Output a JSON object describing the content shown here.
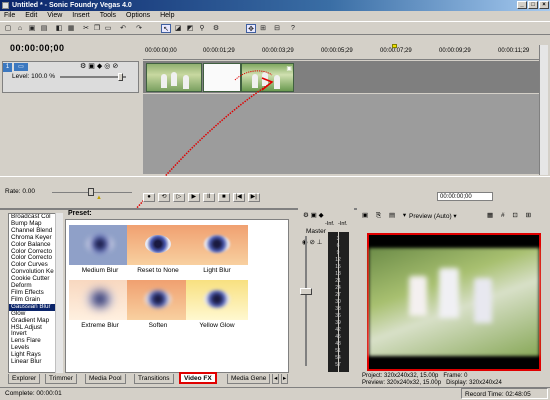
{
  "window": {
    "title": "Untitled * - Sonic Foundry Vegas 4.0",
    "controls": [
      "_",
      "□",
      "×"
    ]
  },
  "menu": [
    "File",
    "Edit",
    "View",
    "Insert",
    "Tools",
    "Options",
    "Help"
  ],
  "toolbar": {
    "icons": [
      "new-icon",
      "open-icon",
      "save-icon",
      "save-as-icon",
      "render-icon",
      "properties-icon",
      "cut-icon",
      "copy-icon",
      "paste-icon",
      "undo-icon",
      "redo-icon",
      "normal-edit-tool-icon",
      "envelope-tool-icon",
      "selection-tool-icon",
      "zoom-tool-icon",
      "snapping-icon",
      "auto-ripple-icon",
      "lock-envelopes-icon",
      "ignore-grouping-icon",
      "help-icon"
    ]
  },
  "timeline": {
    "timecode": "00:00:00;00",
    "ruler_ticks": [
      "00:00:00;00",
      "00:00:01;29",
      "00:00:03;29",
      "00:00:05;29",
      "00:00:07;29",
      "00:00:09;29",
      "00:00:11;29"
    ],
    "track": {
      "number": "1",
      "level_label": "Level: 100.0 %"
    },
    "rate_label": "Rate: 0.00",
    "end_timecode": "00:00:00;00"
  },
  "transport": [
    "●",
    "⟲",
    "▷",
    "▶",
    "II",
    "■",
    "|◀",
    "▶|"
  ],
  "fx_list": [
    "Broadcast Col",
    "Bump Map",
    "Channel Blend",
    "Chroma Keyer",
    "Color Balance",
    "Color Correcto",
    "Color Correcto",
    "Color Curves",
    "Convolution Ke",
    "Cookie Cutter",
    "Deform",
    "Film Effects",
    "Film Grain",
    "Gaussian Blur",
    "Glow",
    "Gradient Map",
    "HSL Adjust",
    "Invert",
    "Lens Flare",
    "Levels",
    "Light Rays",
    "Linear Blur"
  ],
  "fx_selected": "Gaussian Blur",
  "preset": {
    "label": "Preset:",
    "items": [
      "Medium Blur",
      "Reset to None",
      "Light Blur",
      "Extreme Blur",
      "Soften",
      "Yellow Glow"
    ]
  },
  "tabs": [
    "Explorer",
    "Trimmer",
    "Media Pool",
    "Transitions",
    "Video FX",
    "Media Gene"
  ],
  "active_tab": "Video FX",
  "mixer": {
    "label": "Master",
    "inf1": "-Inf.",
    "inf2": "-Inf.",
    "ticks": [
      "3",
      "6",
      "9",
      "12",
      "15",
      "18",
      "21",
      "24",
      "27",
      "30",
      "33",
      "36",
      "39",
      "42",
      "45",
      "48",
      "51",
      "54",
      "57"
    ]
  },
  "preview": {
    "mode": "Preview (Auto)",
    "project_label": "Project:",
    "project_value": "320x240x32, 15.00p",
    "preview_label": "Preview:",
    "preview_value": "320x240x32, 15.00p",
    "frame_label": "Frame:",
    "frame_value": "0",
    "display_label": "Display:",
    "display_value": "320x240x24"
  },
  "status": {
    "complete": "Complete: 00:00:01",
    "record_time": "Record Time: 02:48:05"
  }
}
